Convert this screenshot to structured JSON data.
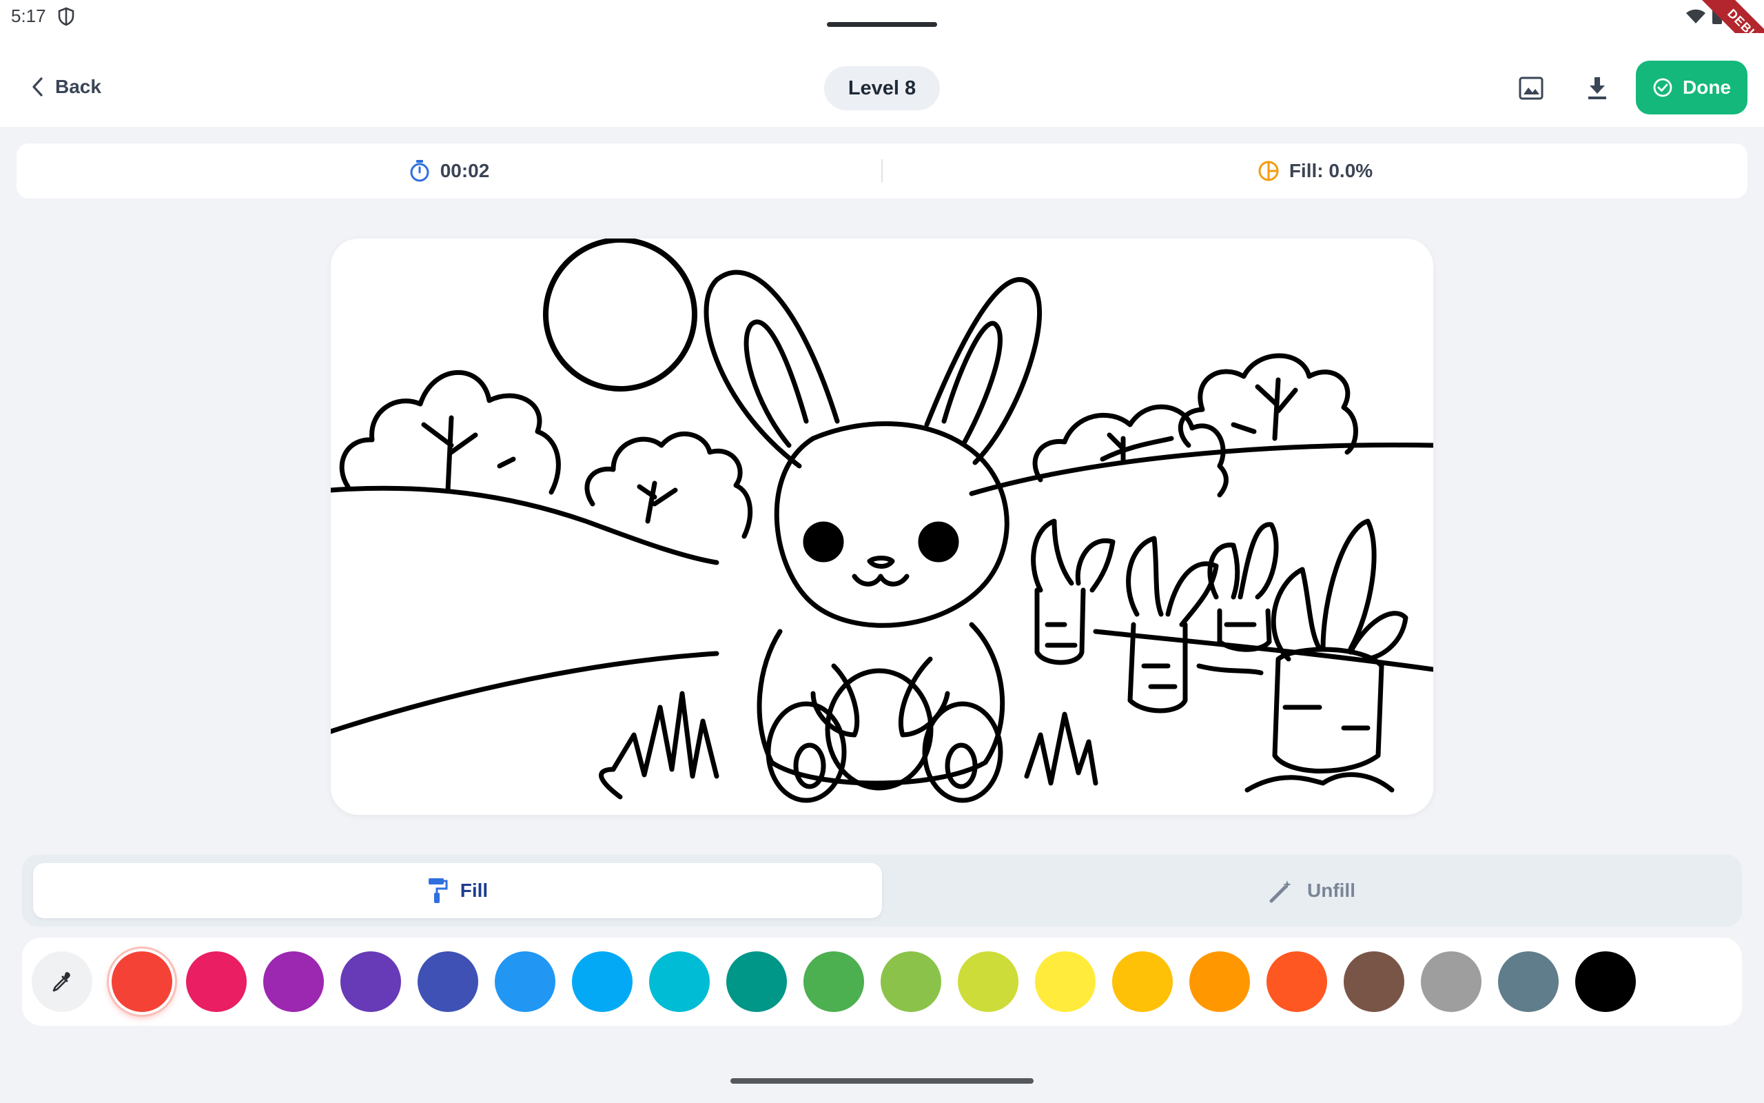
{
  "status_bar": {
    "time": "5:17",
    "debug_label": "DEBUG"
  },
  "app_bar": {
    "back_label": "Back",
    "level_label": "Level 8",
    "done_label": "Done",
    "accent": "#14b87a"
  },
  "stats": {
    "timer": "00:02",
    "fill": "Fill: 0.0%"
  },
  "mode": {
    "fill_label": "Fill",
    "unfill_label": "Unfill",
    "active": "fill"
  },
  "palette": {
    "selected_index": 0,
    "colors": [
      "#f44336",
      "#e91e63",
      "#9c27b0",
      "#673ab7",
      "#3f51b5",
      "#2196f3",
      "#03a9f4",
      "#00bcd4",
      "#009688",
      "#4caf50",
      "#8bc34a",
      "#cddc39",
      "#ffeb3b",
      "#ffc107",
      "#ff9800",
      "#ff5722",
      "#795548",
      "#9e9e9e",
      "#607d8b",
      "#000000"
    ]
  }
}
